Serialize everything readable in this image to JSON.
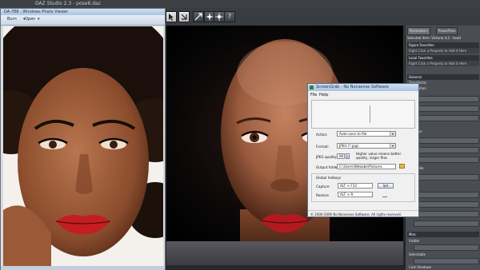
{
  "daz": {
    "title": "DAZ Studio 2.3 - pose6.daz"
  },
  "photo_viewer": {
    "title": "DA-788 - Windows Photo Viewer",
    "menu": [
      "Burn",
      "Open"
    ]
  },
  "toolbar": {
    "icons": [
      "pointer-icon",
      "rotate-icon",
      "translate-icon",
      "sparkle-icon",
      "joint-icon",
      "help-icon"
    ],
    "help_label": "?"
  },
  "right_panel": {
    "tabs": [
      "Parameters",
      "PowerPose"
    ],
    "selected_item": "Selected item:  Victoria 4.2 : head",
    "sections": [
      {
        "header": "Figure Favorites",
        "hint": "Right Click a Property to Add it Here"
      },
      {
        "header": "Local Favorites",
        "hint": "Right Click a Property to Add it Here"
      }
    ],
    "general_header": "General",
    "items": [
      "Transforms",
      "Translation",
      "Rotation",
      "Side Side",
      "Scale",
      "Misc"
    ],
    "misc_items": [
      "Visible",
      "Selectable",
      "Cast Shadows"
    ]
  },
  "dialog": {
    "title": "ScreenGrab - No Nonsense Software",
    "menu": [
      "File",
      "Help"
    ],
    "action_label": "Action:",
    "action_value": "Auto-save to file",
    "format_label": "Format:",
    "format_value": "JPEG (*.jpg)",
    "quality_label": "JPEG quality:",
    "quality_value": "80",
    "quality_hint_1": "Higher value means better",
    "quality_hint_2": "quality, larger files",
    "folder_label": "Output folder:",
    "folder_value": "C:\\Users\\Webabe\\Pictures",
    "hotkeys_title": "Global hotkeys",
    "capture_label": "Capture",
    "capture_value": "ALT + F12",
    "capture_button": "Set",
    "restore_label": "Restore",
    "restore_value": "ALT + R",
    "status": "© 2000-2006 No Nonsense Software. All rights reserved."
  },
  "colors": {
    "daz_bg": "#2a2c2f",
    "panel": "#4a4e54",
    "dialog_bg": "#f0f0f0",
    "skin": "#a8694a",
    "lips": "#c41d22"
  }
}
